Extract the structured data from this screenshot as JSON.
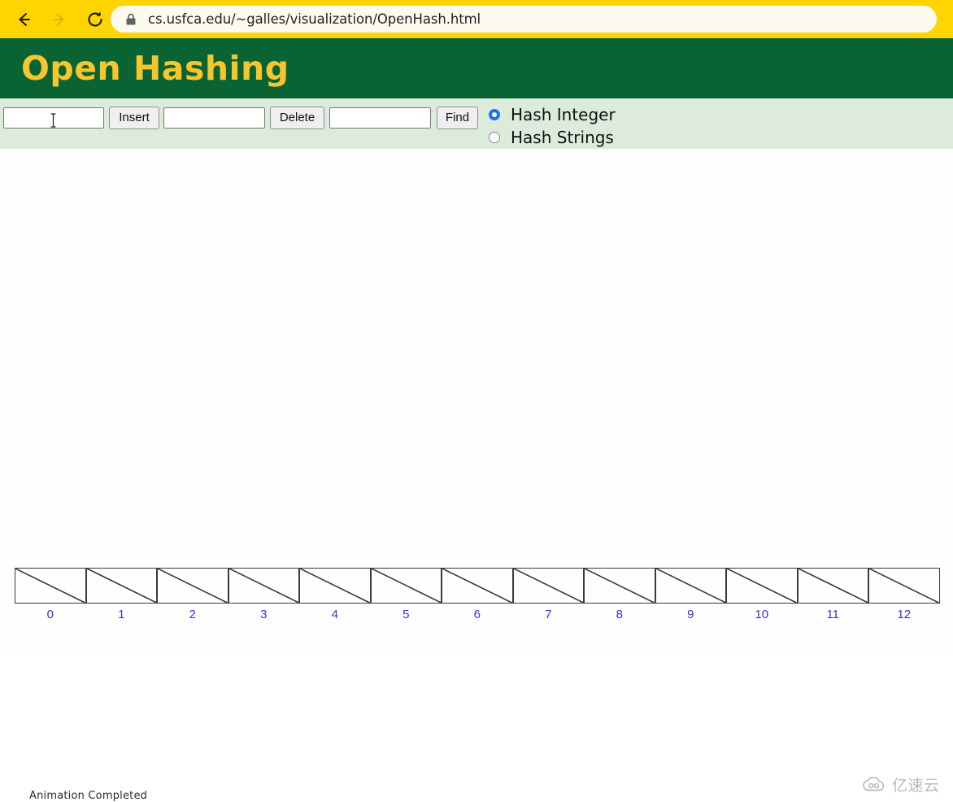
{
  "browser": {
    "back_icon": "back-arrow-icon",
    "forward_icon": "forward-arrow-icon",
    "reload_icon": "reload-icon",
    "lock_icon": "lock-icon",
    "url": "cs.usfca.edu/~galles/visualization/OpenHash.html",
    "chrome_color": "#FFD400",
    "url_pill_color": "#FDFBF0"
  },
  "header": {
    "title": "Open Hashing",
    "bg_color": "#096332",
    "title_color": "#F7C52D"
  },
  "controls": {
    "bar_color": "#DCEBDC",
    "insert_value": "",
    "insert_placeholder": "",
    "insert_label": "Insert",
    "delete_value": "",
    "delete_placeholder": "",
    "delete_label": "Delete",
    "find_value": "",
    "find_placeholder": "",
    "find_label": "Find",
    "caret_icon": "text-cursor-icon"
  },
  "hash_mode": {
    "selected": "Hash Integer",
    "accent_color": "#1A73E8",
    "options": [
      {
        "label": "Hash Integer",
        "selected": true
      },
      {
        "label": "Hash Strings",
        "selected": false
      }
    ]
  },
  "table": {
    "index_color": "#3A33CC",
    "cell_border_color": "#3A3A3A",
    "buckets": [
      {
        "index": "0",
        "value": "",
        "empty": true
      },
      {
        "index": "1",
        "value": "",
        "empty": true
      },
      {
        "index": "2",
        "value": "",
        "empty": true
      },
      {
        "index": "3",
        "value": "",
        "empty": true
      },
      {
        "index": "4",
        "value": "",
        "empty": true
      },
      {
        "index": "5",
        "value": "",
        "empty": true
      },
      {
        "index": "6",
        "value": "",
        "empty": true
      },
      {
        "index": "7",
        "value": "",
        "empty": true
      },
      {
        "index": "8",
        "value": "",
        "empty": true
      },
      {
        "index": "9",
        "value": "",
        "empty": true
      },
      {
        "index": "10",
        "value": "",
        "empty": true
      },
      {
        "index": "11",
        "value": "",
        "empty": true
      },
      {
        "index": "12",
        "value": "",
        "empty": true
      }
    ]
  },
  "status": {
    "message": "Animation Completed"
  },
  "watermark": {
    "text": "亿速云",
    "icon": "cloud-icon"
  }
}
